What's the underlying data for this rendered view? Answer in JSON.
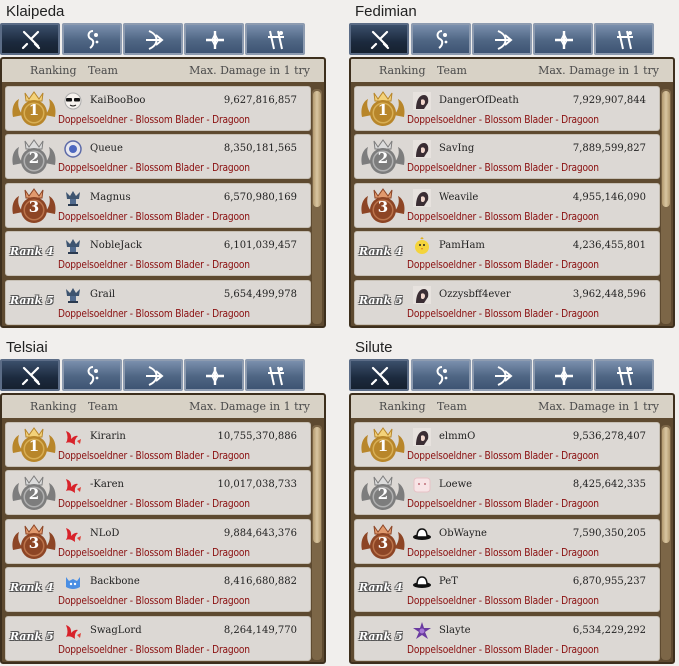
{
  "columns": {
    "ranking": "Ranking",
    "team": "Team",
    "damage": "Max. Damage in 1 try"
  },
  "servers": [
    {
      "name": "Klaipeda",
      "rows": [
        {
          "rank": "1",
          "team": "KaiBooBoo",
          "damage": "9,627,816,857",
          "classes": "Doppelsoeldner - Blossom Blader - Dragoon",
          "icon": "sunglasses-face-icon"
        },
        {
          "rank": "2",
          "team": "Queue",
          "damage": "8,350,181,565",
          "classes": "Doppelsoeldner - Blossom Blader - Dragoon",
          "icon": "round-badge-icon"
        },
        {
          "rank": "3",
          "team": "Magnus",
          "damage": "6,570,980,169",
          "classes": "Doppelsoeldner - Blossom Blader - Dragoon",
          "icon": "guild-crest-icon"
        },
        {
          "rank": "Rank 4",
          "team": "NobleJack",
          "damage": "6,101,039,457",
          "classes": "Doppelsoeldner - Blossom Blader - Dragoon",
          "icon": "guild-crest-icon"
        },
        {
          "rank": "Rank 5",
          "team": "Grail",
          "damage": "5,654,499,978",
          "classes": "Doppelsoeldner - Blossom Blader - Dragoon",
          "icon": "guild-crest-icon"
        }
      ]
    },
    {
      "name": "Fedimian",
      "rows": [
        {
          "rank": "1",
          "team": "DangerOfDeath",
          "damage": "7,929,907,844",
          "classes": "Doppelsoeldner - Blossom Blader - Dragoon",
          "icon": "portrait-icon"
        },
        {
          "rank": "2",
          "team": "SavIng",
          "damage": "7,889,599,827",
          "classes": "Doppelsoeldner - Blossom Blader - Dragoon",
          "icon": "portrait-icon"
        },
        {
          "rank": "3",
          "team": "Weavile",
          "damage": "4,955,146,090",
          "classes": "Doppelsoeldner - Blossom Blader - Dragoon",
          "icon": "portrait-icon"
        },
        {
          "rank": "Rank 4",
          "team": "PamHam",
          "damage": "4,236,455,801",
          "classes": "Doppelsoeldner - Blossom Blader - Dragoon",
          "icon": "chick-icon"
        },
        {
          "rank": "Rank 5",
          "team": "Ozzysbff4ever",
          "damage": "3,962,448,596",
          "classes": "Doppelsoeldner - Blossom Blader - Dragoon",
          "icon": "portrait-icon"
        }
      ]
    },
    {
      "name": "Telsiai",
      "rows": [
        {
          "rank": "1",
          "team": "Kirarin",
          "damage": "10,755,370,886",
          "classes": "Doppelsoeldner - Blossom Blader - Dragoon",
          "icon": "red-emblem-icon"
        },
        {
          "rank": "2",
          "team": "-Karen",
          "damage": "10,017,038,733",
          "classes": "Doppelsoeldner - Blossom Blader - Dragoon",
          "icon": "red-emblem-icon"
        },
        {
          "rank": "3",
          "team": "NLoD",
          "damage": "9,884,643,376",
          "classes": "Doppelsoeldner - Blossom Blader - Dragoon",
          "icon": "red-emblem-icon"
        },
        {
          "rank": "Rank 4",
          "team": "Backbone",
          "damage": "8,416,680,882",
          "classes": "Doppelsoeldner - Blossom Blader - Dragoon",
          "icon": "blue-cat-icon"
        },
        {
          "rank": "Rank 5",
          "team": "SwagLord",
          "damage": "8,264,149,770",
          "classes": "Doppelsoeldner - Blossom Blader - Dragoon",
          "icon": "red-emblem-icon"
        }
      ]
    },
    {
      "name": "Silute",
      "rows": [
        {
          "rank": "1",
          "team": "elmmO",
          "damage": "9,536,278,407",
          "classes": "Doppelsoeldner - Blossom Blader - Dragoon",
          "icon": "portrait-icon"
        },
        {
          "rank": "2",
          "team": "Loewe",
          "damage": "8,425,642,335",
          "classes": "Doppelsoeldner - Blossom Blader - Dragoon",
          "icon": "pink-face-icon"
        },
        {
          "rank": "3",
          "team": "ObWayne",
          "damage": "7,590,350,205",
          "classes": "Doppelsoeldner - Blossom Blader - Dragoon",
          "icon": "hat-icon"
        },
        {
          "rank": "Rank 4",
          "team": "PeT",
          "damage": "6,870,955,237",
          "classes": "Doppelsoeldner - Blossom Blader - Dragoon",
          "icon": "hat-icon"
        },
        {
          "rank": "Rank 5",
          "team": "Slayte",
          "damage": "6,534,229,292",
          "classes": "Doppelsoeldner - Blossom Blader - Dragoon",
          "icon": "purple-star-icon"
        }
      ]
    }
  ],
  "tabs": [
    "sword-class-icon",
    "wizard-class-icon",
    "archer-class-icon",
    "cleric-class-icon",
    "scout-class-icon"
  ],
  "colors": {
    "gold": "#d9a93a",
    "silver": "#9a9a9a",
    "bronze": "#b5663d",
    "class_text": "#8a0f0f",
    "tab_active": "#1c2a3e",
    "tab": "#4f6684"
  }
}
